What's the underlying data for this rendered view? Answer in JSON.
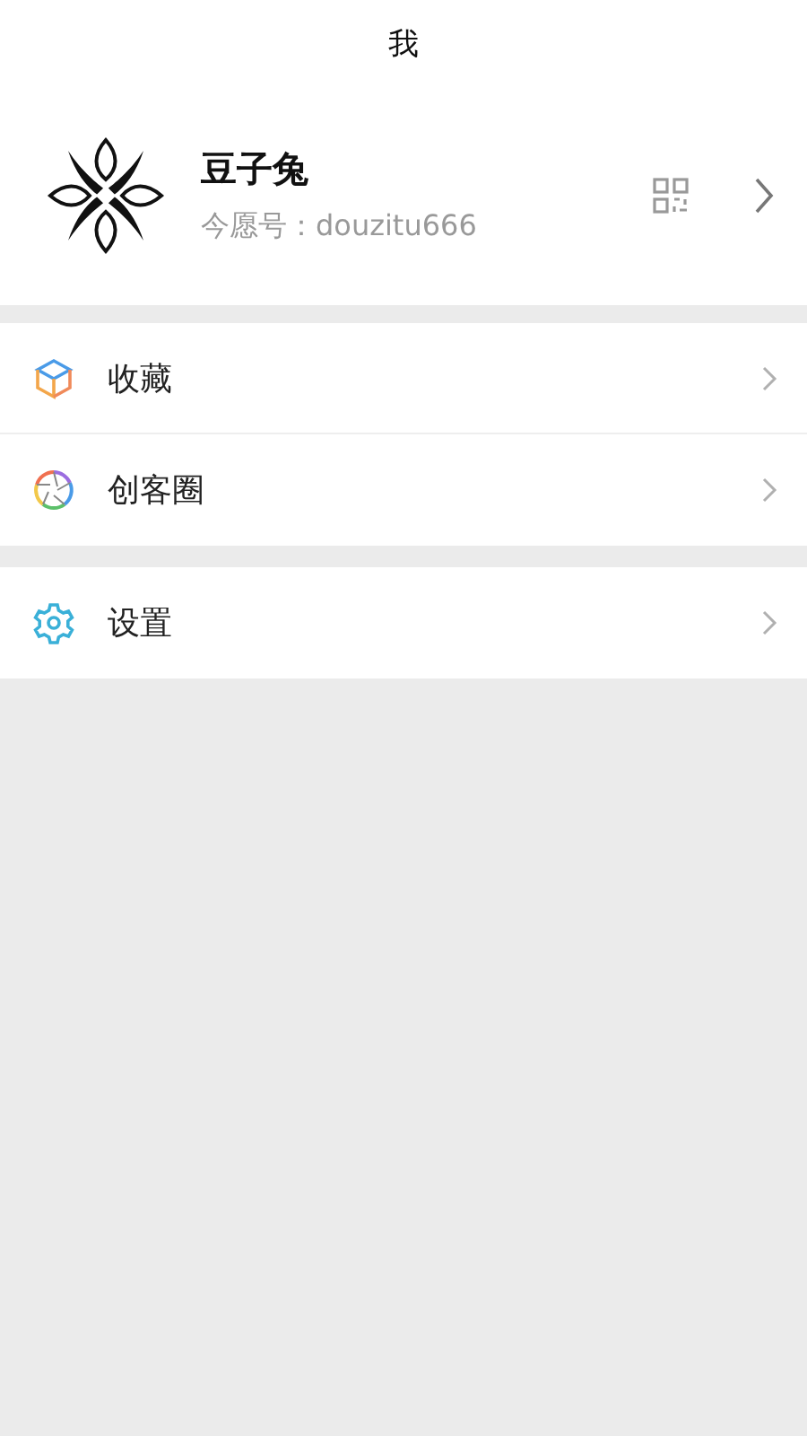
{
  "header": {
    "title": "我"
  },
  "profile": {
    "name": "豆子兔",
    "account": "今愿号：douzitu666"
  },
  "menu_groups": [
    {
      "items": [
        {
          "kind": "favorites",
          "label": "收藏"
        },
        {
          "kind": "circle",
          "label": "创客圈"
        }
      ]
    },
    {
      "items": [
        {
          "kind": "settings",
          "label": "设置"
        }
      ]
    }
  ]
}
